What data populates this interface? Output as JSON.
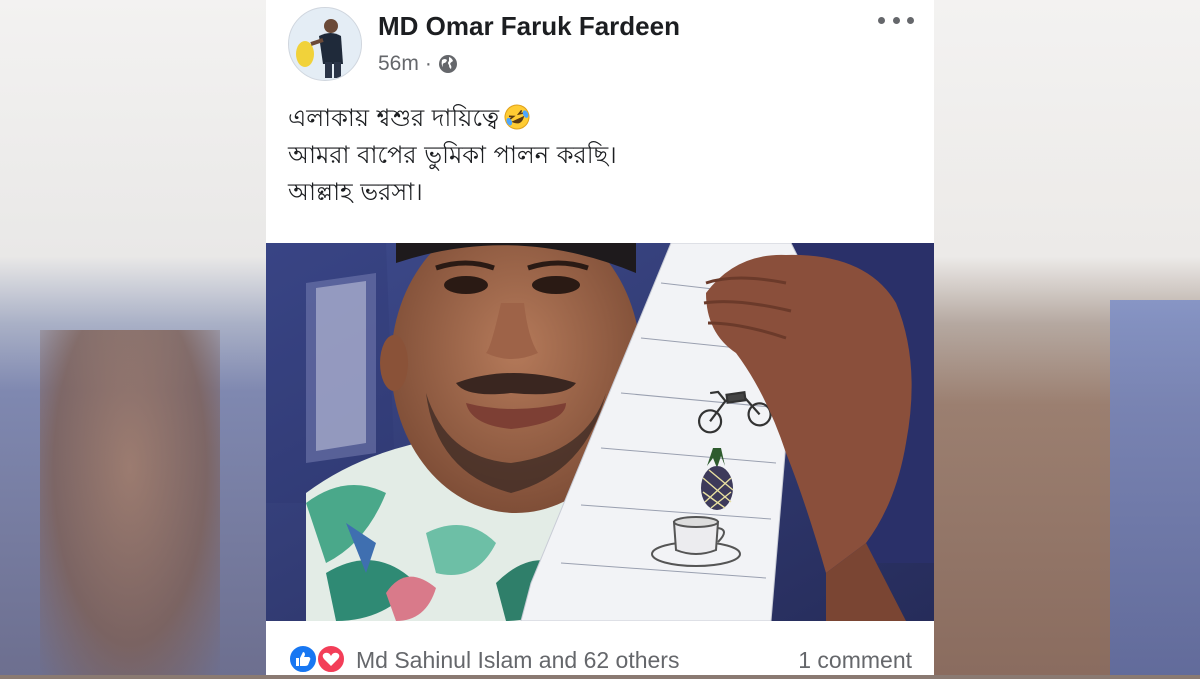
{
  "post": {
    "author": "MD Omar Faruk Fardeen",
    "time": "56m",
    "separator": "·",
    "privacy_icon": "globe-icon",
    "text_lines": [
      "এলাকায় শ্বশুর দায়িত্বে",
      "আমরা বাপের ভুমিকা পালন করছি।",
      "আল্লাহ ভরসা।"
    ],
    "emoji": "rolling-on-floor-laughing-emoji",
    "photo_sheet_items": [
      "মোটরসাইকেল",
      "আনারস",
      "কাপ"
    ]
  },
  "footer": {
    "reactions": [
      "like-icon",
      "love-icon"
    ],
    "reactors_text": "Md Sahinul Islam and 62 others",
    "comments_text": "1 comment"
  },
  "colors": {
    "like": "#1877f2",
    "love": "#f33e58",
    "secondary_text": "#65676b",
    "primary_text": "#1c1e21"
  }
}
